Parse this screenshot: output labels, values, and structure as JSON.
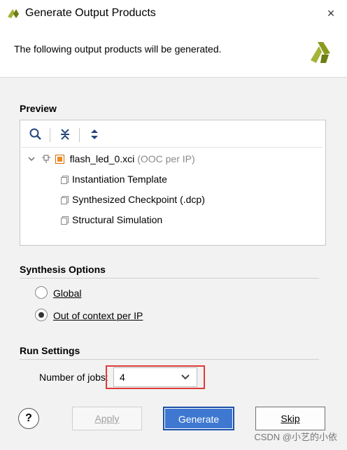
{
  "window": {
    "title": "Generate Output Products",
    "close_glyph": "×"
  },
  "header": {
    "text": "The following output products will be generated."
  },
  "preview": {
    "title": "Preview",
    "toolbar": {
      "search_icon": "search-icon",
      "collapse_icon": "collapse-all-icon",
      "expand_icon": "expand-all-icon"
    },
    "tree": {
      "root_name": "flash_led_0.xci",
      "root_suffix": "(OOC per IP)",
      "children": [
        "Instantiation Template",
        "Synthesized Checkpoint (.dcp)",
        "Structural Simulation"
      ]
    }
  },
  "synthesis_options": {
    "title": "Synthesis Options",
    "options": [
      "Global",
      "Out of context per IP"
    ],
    "selected": "Out of context per IP"
  },
  "run_settings": {
    "title": "Run Settings",
    "jobs_label": "Number of jobs:",
    "jobs_value": "4"
  },
  "buttons": {
    "help": "?",
    "apply": "Apply",
    "generate": "Generate",
    "skip": "Skip"
  },
  "watermark": "CSDN @小艺的小依",
  "colors": {
    "accent_highlight": "#e03a3a",
    "primary_button": "#3f78d1",
    "dialog_background": "#f2f2f2",
    "logo_green": "#8a9a1c"
  }
}
